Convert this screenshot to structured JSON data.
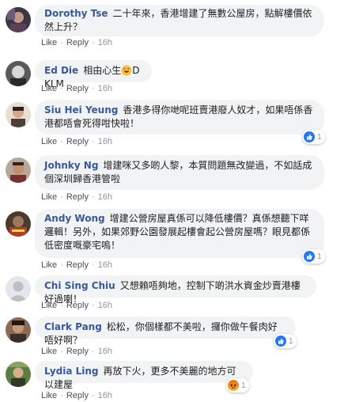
{
  "actions": {
    "like": "Like",
    "reply": "Reply"
  },
  "comments": [
    {
      "author": "Dorothy Tse",
      "text": "二十年來，香港增建了無數公屋房，點解樓價依然上升？",
      "time": "16h",
      "reaction": null
    },
    {
      "author": "Ed Die",
      "text": "相由心生",
      "text_after": "DKLM",
      "emoji": "rofl-emoji",
      "time": "16h",
      "reaction": null
    },
    {
      "author": "Siu Hei Yeung",
      "text": "香港多得你哋呢班賣港廢人奴才，如果唔係香港都唔會死得咁快啦！",
      "time": "16h",
      "reaction": {
        "type": "like",
        "count": "1"
      }
    },
    {
      "author": "Johnky Ng",
      "text": "增建咪又多啲人黎，本質問題無改變過，不如話成個深圳歸香港管啦",
      "time": "16h",
      "reaction": null
    },
    {
      "author": "Andy Wong",
      "text": "增建公營房屋真係可以降低樓價？真係想聽下咩邏輯！另外，如果郊野公園發展起樓會起公營房屋嗎？眼見都係低密度嘅豪宅嗚！",
      "time": "16h",
      "reaction": {
        "type": "like",
        "count": "1"
      }
    },
    {
      "author": "Chi Sing Chiu",
      "text": "又想賴唔夠地，控制下啲洪水資金炒賣港樓好過喇！",
      "time": "16h",
      "reaction": null
    },
    {
      "author": "Clark Pang",
      "text": "松松，你個樣都不美啦，攞你做午餐肉好唔好啊？",
      "time": "16h",
      "reaction": {
        "type": "like",
        "count": "1"
      }
    },
    {
      "author": "Lydia Ling",
      "text": "再放下火，更多不美麗的地方可以建屋",
      "time": "16h",
      "reaction": {
        "type": "angry",
        "count": "1"
      }
    }
  ],
  "colors": {
    "author": "#385898",
    "bubble": "#f2f3f5",
    "like_blue": "#2078f4"
  }
}
